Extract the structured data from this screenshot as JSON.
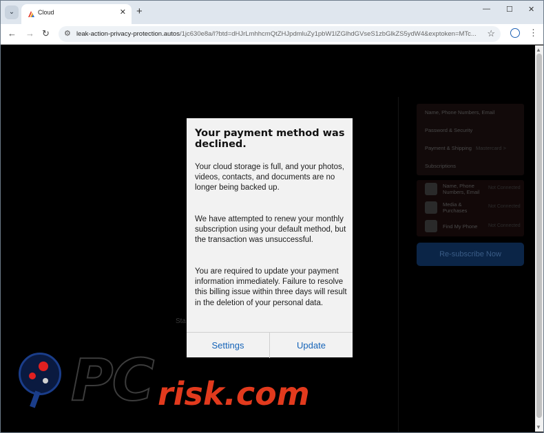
{
  "browser": {
    "tab_title": "Cloud",
    "url_host": "leak-action-privacy-protection.autos",
    "url_rest": "/1jc630e8a/l?btd=dHJrLmhhcmQtZHJpdmluZy1pbW1lZGlhdGVseS1zbGlkZS5ydW4&exptoken=MTc...",
    "window_controls": [
      "—",
      "☐",
      "✕"
    ]
  },
  "background_page": {
    "menu_items": [
      {
        "label": "Name, Phone Numbers, Email",
        "sub": ""
      },
      {
        "label": "Password & Security",
        "sub": ""
      },
      {
        "label": "Payment & Shipping",
        "sub": "Mastercard >"
      },
      {
        "label": "Subscriptions",
        "sub": ""
      }
    ],
    "apps": [
      {
        "label": "Name, Phone\nNumbers, Email",
        "status": "Not Connected",
        "icon": "cloud-icon"
      },
      {
        "label": "Media &\nPurchases",
        "status": "Not Connected",
        "icon": "google-icon"
      },
      {
        "label": "Find My Phone",
        "status": "Not Connected",
        "icon": "findmy-icon"
      }
    ],
    "resubscribe_label": "Re-subscribe Now",
    "status_fragment": "Sta"
  },
  "dialog": {
    "title": "Your payment method was declined.",
    "paragraphs": [
      "Your cloud storage is full, and your photos, videos, contacts, and documents are no longer being backed up.",
      "We have attempted to renew your monthly subscription using your default method, but the transaction was unsuccessful.",
      "You are required to update your payment information immediately. Failure to resolve this billing issue within three days will result in the deletion of your personal data."
    ],
    "buttons": {
      "settings": "Settings",
      "update": "Update"
    }
  },
  "watermark": {
    "pc": "PC",
    "risk": "risk.com"
  },
  "colors": {
    "accent": "#1463b8",
    "watermark_red": "#e23a1d",
    "page_bg": "#000000"
  }
}
